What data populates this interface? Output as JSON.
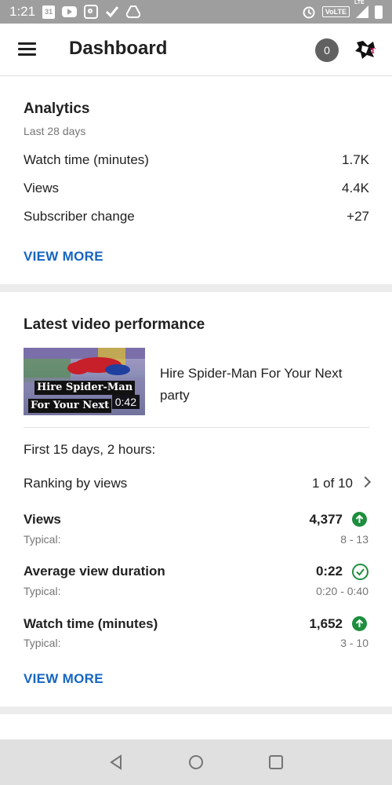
{
  "status_bar": {
    "time": "1:21",
    "calendar_day": "31",
    "network": "VoLTE",
    "signal_label": "LTE"
  },
  "app_bar": {
    "title": "Dashboard",
    "notification_count": "0"
  },
  "analytics": {
    "title": "Analytics",
    "period": "Last 28 days",
    "rows": [
      {
        "label": "Watch time (minutes)",
        "value": "1.7K"
      },
      {
        "label": "Views",
        "value": "4.4K"
      },
      {
        "label": "Subscriber change",
        "value": "+27"
      }
    ],
    "view_more": "VIEW MORE"
  },
  "latest_video": {
    "title": "Latest video performance",
    "thumbnail_caption_line1": "Hire Spider-Man",
    "thumbnail_caption_line2": "For Your Next",
    "duration": "0:42",
    "video_title": "Hire Spider-Man For Your Next party",
    "first_period": "First 15 days, 2 hours:",
    "ranking_label": "Ranking by views",
    "ranking_value": "1 of 10",
    "metrics": [
      {
        "label": "Views",
        "value": "4,377",
        "typical_label": "Typical:",
        "typical_value": "8 - 13",
        "indicator": "arrow-up"
      },
      {
        "label": "Average view duration",
        "value": "0:22",
        "typical_label": "Typical:",
        "typical_value": "0:20 - 0:40",
        "indicator": "check"
      },
      {
        "label": "Watch time (minutes)",
        "value": "1,652",
        "typical_label": "Typical:",
        "typical_value": "3 - 10",
        "indicator": "arrow-up"
      }
    ],
    "view_more": "VIEW MORE"
  },
  "colors": {
    "accent_link": "#1565c0",
    "positive": "#1e8e3e",
    "status_bar": "#9e9e9e",
    "nav_bar": "#e0e0e0"
  }
}
